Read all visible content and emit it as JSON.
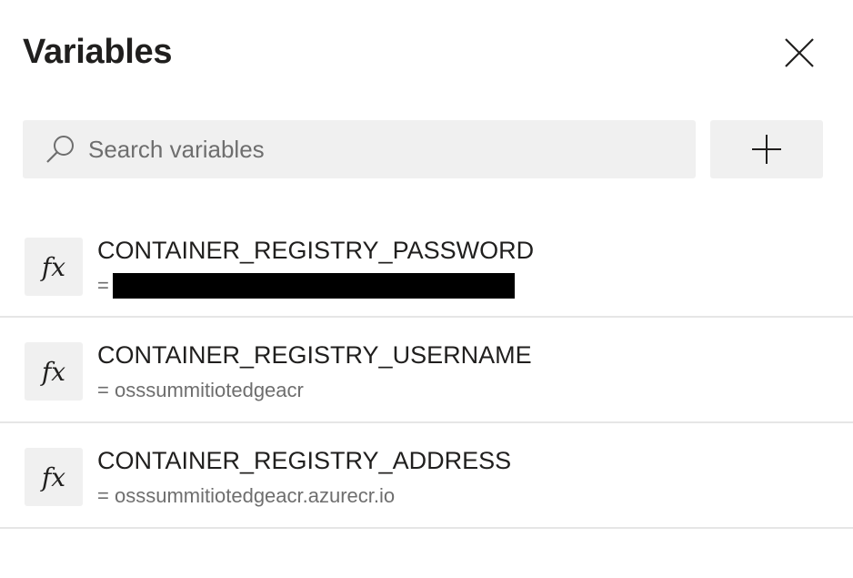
{
  "panel": {
    "title": "Variables",
    "close_icon": "close-icon"
  },
  "search": {
    "placeholder": "Search variables",
    "value": "",
    "icon": "search-icon"
  },
  "add_button": {
    "icon": "plus-icon"
  },
  "variables": [
    {
      "icon_label": "fx",
      "name": "CONTAINER_REGISTRY_PASSWORD",
      "prefix": "=",
      "value": "",
      "redacted": true
    },
    {
      "icon_label": "fx",
      "name": "CONTAINER_REGISTRY_USERNAME",
      "prefix": "=",
      "value": "osssummitiotedgeacr",
      "redacted": false
    },
    {
      "icon_label": "fx",
      "name": "CONTAINER_REGISTRY_ADDRESS",
      "prefix": "=",
      "value": "osssummitiotedgeacr.azurecr.io",
      "redacted": false
    }
  ],
  "colors": {
    "background": "#ffffff",
    "control_fill": "#f0f0f0",
    "text_primary": "#201f1e",
    "text_secondary": "#6e6e6e",
    "divider": "#e6e6e6",
    "redaction": "#000000"
  }
}
